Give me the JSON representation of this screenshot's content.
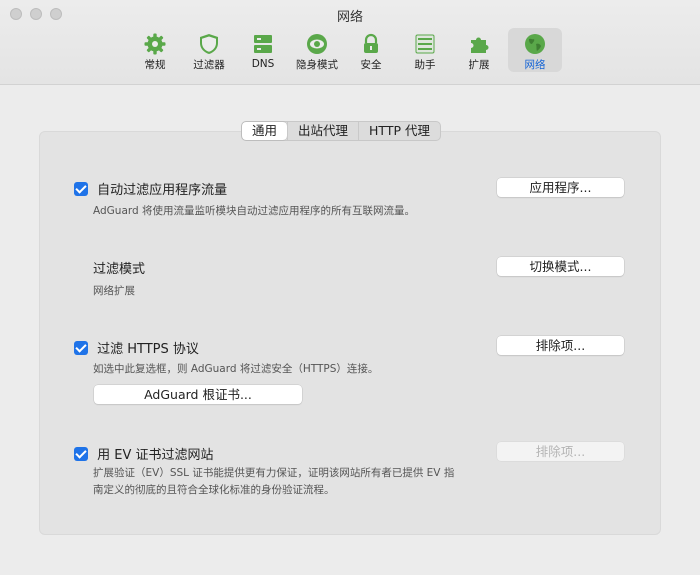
{
  "window": {
    "title": "网络"
  },
  "toolbar": {
    "items": [
      {
        "label": "常规",
        "icon": "gear-icon"
      },
      {
        "label": "过滤器",
        "icon": "shield-icon"
      },
      {
        "label": "DNS",
        "icon": "server-icon"
      },
      {
        "label": "隐身模式",
        "icon": "eye-icon"
      },
      {
        "label": "安全",
        "icon": "lock-icon"
      },
      {
        "label": "助手",
        "icon": "list-icon"
      },
      {
        "label": "扩展",
        "icon": "puzzle-icon"
      },
      {
        "label": "网络",
        "icon": "globe-icon"
      }
    ],
    "active": "网络"
  },
  "tabs": {
    "items": [
      "通用",
      "出站代理",
      "HTTP 代理"
    ],
    "selected": "通用"
  },
  "settings": {
    "auto_filter": {
      "checked": true,
      "label": "自动过滤应用程序流量",
      "description": "AdGuard 将使用流量监听模块自动过滤应用程序的所有互联网流量。",
      "button": "应用程序..."
    },
    "filter_mode": {
      "label": "过滤模式",
      "value": "网络扩展",
      "button": "切换模式..."
    },
    "https": {
      "checked": true,
      "label": "过滤 HTTPS 协议",
      "description": "如选中此复选框，则 AdGuard 将过滤安全（HTTPS）连接。",
      "button": "排除项...",
      "cert_button": "AdGuard 根证书..."
    },
    "ev": {
      "checked": true,
      "label": "用 EV 证书过滤网站",
      "description_line1": "扩展验证（EV）SSL 证书能提供更有力保证，证明该网站所有者已提供 EV 指",
      "description_line2": "南定义的彻底的且符合全球化标准的身份验证流程。",
      "button": "排除项...",
      "button_disabled": true
    }
  },
  "colors": {
    "accent": "#1f73e8",
    "active_tab_text": "#1665d6",
    "icon_green": "#5aa84a"
  }
}
